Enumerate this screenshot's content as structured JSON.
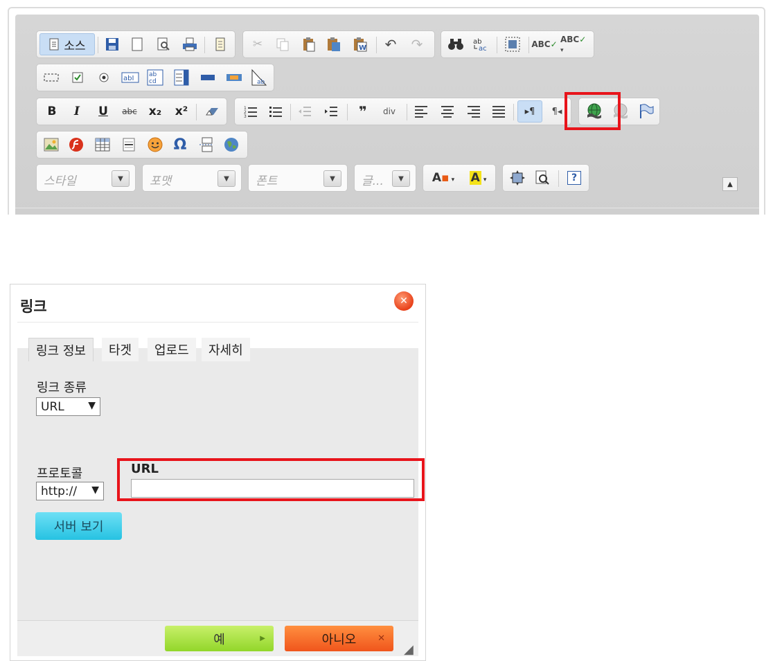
{
  "toolbar": {
    "source_label": "소스",
    "combos": {
      "style": "스타일",
      "format": "포맷",
      "font": "폰트",
      "size": "글..."
    },
    "icons": {
      "row1": [
        "source-icon",
        "save-icon",
        "new-page-icon",
        "preview-icon",
        "print-icon",
        "templates-icon",
        "cut-icon",
        "copy-icon",
        "paste-icon",
        "paste-text-icon",
        "paste-word-icon",
        "undo-icon",
        "redo-icon",
        "find-icon",
        "replace-icon",
        "select-all-icon",
        "spellcheck-icon",
        "scayt-icon"
      ],
      "row2": [
        "form-icon",
        "checkbox-icon",
        "radio-icon",
        "textfield-icon",
        "textarea-icon",
        "select-icon",
        "button-icon",
        "image-button-icon",
        "hidden-field-icon"
      ],
      "row3": [
        "bold-icon",
        "italic-icon",
        "underline-icon",
        "strike-icon",
        "subscript-icon",
        "superscript-icon",
        "remove-format-icon",
        "numbered-list-icon",
        "bulleted-list-icon",
        "outdent-icon",
        "indent-icon",
        "blockquote-icon",
        "create-div-icon",
        "align-left-icon",
        "align-center-icon",
        "align-right-icon",
        "justify-icon",
        "bidi-ltr-icon",
        "bidi-rtl-icon",
        "link-icon",
        "unlink-icon",
        "anchor-icon"
      ],
      "row4": [
        "image-icon",
        "flash-icon",
        "table-icon",
        "horizontal-rule-icon",
        "smiley-icon",
        "special-char-icon",
        "page-break-icon",
        "iframe-icon"
      ],
      "row5": [
        "text-color-icon",
        "bg-color-icon",
        "maximize-icon",
        "show-blocks-icon",
        "about-icon"
      ]
    },
    "glyphs": {
      "bold": "B",
      "italic": "I",
      "underline": "U",
      "strike": "abc",
      "subscript": "x₂",
      "superscript": "x²",
      "special_char": "Ω",
      "spell": "ABC",
      "scayt": "ABC",
      "about": "?",
      "blockquote": "❞",
      "div": "div",
      "text_color": "A",
      "bg_color": "A"
    }
  },
  "dialog": {
    "title": "링크",
    "tabs": [
      "링크 정보",
      "타겟",
      "업로드",
      "자세히"
    ],
    "link_type_label": "링크 종류",
    "link_type_value": "URL",
    "protocol_label": "프로토콜",
    "protocol_value": "http://",
    "url_label": "URL",
    "url_value": "",
    "server_button": "서버 보기",
    "ok_button": "예",
    "cancel_button": "아니오"
  },
  "colors": {
    "highlight": "#e8141b",
    "ok": "#a6e23a",
    "cancel": "#f5661f",
    "server": "#38c9e7"
  }
}
